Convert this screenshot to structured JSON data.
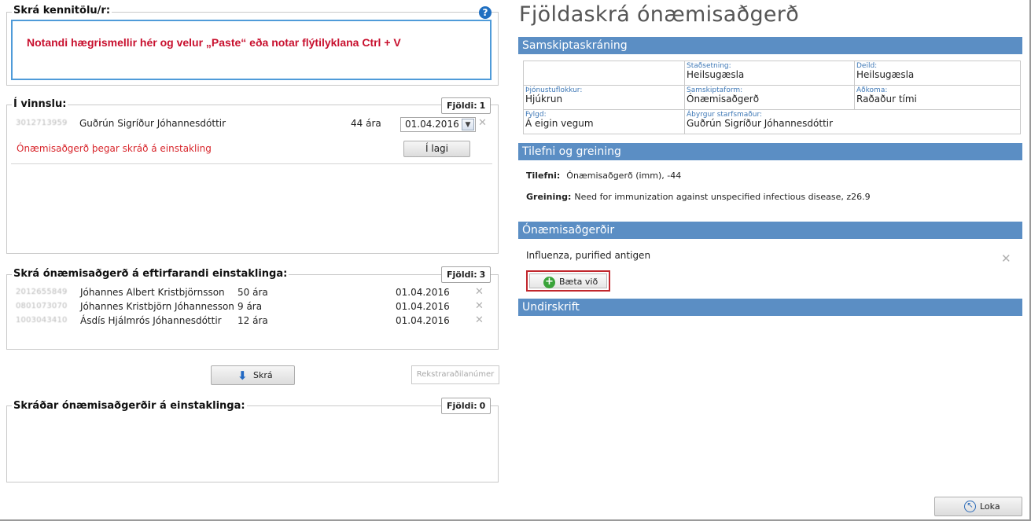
{
  "left": {
    "kennitala": {
      "title": "Skrá kennitölu/r:",
      "instructions": "Notandi hægrismellir hér og velur „Paste“ eða notar flýtilyklana Ctrl + V"
    },
    "in_progress": {
      "title": "Í vinnslu:",
      "count_label": "Fjöldi:",
      "count": "1",
      "row": {
        "id": "3012713959",
        "name": "Guðrún Sigríður Jóhannesdóttir",
        "age": "44 ára",
        "date": "01.04.2016"
      },
      "warning": "Ónæmisaðgerð þegar skráð á einstakling",
      "ok_button": "Í lagi"
    },
    "pending": {
      "title": "Skrá ónæmisaðgerð á eftirfarandi einstaklinga:",
      "count_label": "Fjöldi:",
      "count": "3",
      "rows": [
        {
          "id": "2012655849",
          "name": "Jóhannes Albert Kristbjörnsson",
          "age": "50 ára",
          "date": "01.04.2016"
        },
        {
          "id": "0801073070",
          "name": "Jóhannes Kristbjörn Jóhannesson",
          "age": "9 ára",
          "date": "01.04.2016"
        },
        {
          "id": "1003043410",
          "name": "Ásdís Hjálmrós Jóhannesdóttir",
          "age": "12 ára",
          "date": "01.04.2016"
        }
      ]
    },
    "register_button": "Skrá",
    "batch_placeholder": "Rekstraraðilanúmer",
    "registered": {
      "title": "Skráðar ónæmisaðgerðir á einstaklinga:",
      "count_label": "Fjöldi:",
      "count": "0"
    }
  },
  "right": {
    "title": "Fjöldaskrá ónæmisaðgerð",
    "samskipti": {
      "header": "Samskiptaskráning",
      "cells": [
        {
          "label": "",
          "value": ""
        },
        {
          "label": "Staðsetning:",
          "value": "Heilsugæsla"
        },
        {
          "label": "Deild:",
          "value": "Heilsugæsla"
        },
        {
          "label": "Þjónustuflokkur:",
          "value": "Hjúkrun"
        },
        {
          "label": "Samskiptaform:",
          "value": "Ónæmisaðgerð"
        },
        {
          "label": "Aðkoma:",
          "value": "Raðaður tími"
        },
        {
          "label": "Fylgd:",
          "value": "Á eigin vegum"
        },
        {
          "label": "Ábyrgur starfsmaður:",
          "value": "Guðrún Sigríður Jóhannesdóttir"
        }
      ]
    },
    "tilefni": {
      "header": "Tilefni og greining",
      "tilefni_label": "Tilefni:",
      "tilefni_value": "Ónæmisaðgerð (imm), -44",
      "greining_label": "Greining:",
      "greining_value": "Need for immunization against unspecified infectious disease, z26.9"
    },
    "onaemis": {
      "header": "Ónæmisaðgerðir",
      "item": "Influenza, purified antigen",
      "add_button": "Bæta við"
    },
    "undirskrift": {
      "header": "Undirskrift"
    },
    "close_button": "Loka"
  }
}
